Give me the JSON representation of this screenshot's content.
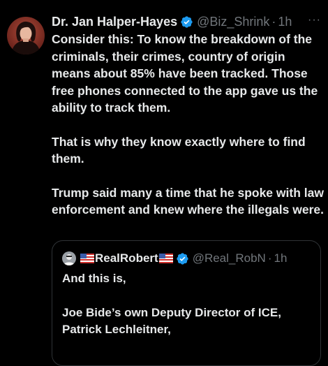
{
  "tweet": {
    "author": {
      "display_name": "Dr. Jan Halper-Hayes",
      "handle": "@Biz_Shrink",
      "verified_icon": "verified-badge-icon",
      "separator": "·",
      "time": "1h"
    },
    "more_label": "···",
    "paragraphs": [
      "Consider this: To know the breakdown of the criminals, their crimes, country of origin means about 85% have been tracked. Those free phones connected to the app gave us the ability to track them.",
      "That is why they know exactly where to find them.",
      "Trump said many a time that he spoke with law enforcement and knew where the illegals were."
    ]
  },
  "quoted": {
    "author": {
      "display_name": "RealRobert",
      "handle": "@Real_RobN",
      "separator": "·",
      "time": "1h",
      "flag_icon": "us-flag-icon"
    },
    "paragraphs": [
      "And this is,",
      "Joe Bide’s own Deputy Director of ICE, Patrick Lechleitner,"
    ]
  },
  "colors": {
    "background": "#000000",
    "text": "#e7e9ea",
    "muted": "#71767b",
    "verified": "#1d9bf0",
    "border": "#2f3336"
  }
}
